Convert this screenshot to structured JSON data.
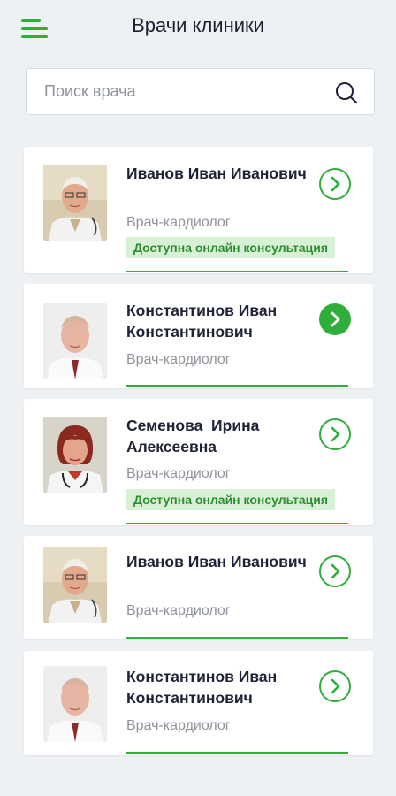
{
  "header": {
    "title": "Врачи клиники",
    "menu_icon": "hamburger-menu-icon"
  },
  "search": {
    "placeholder": "Поиск врача",
    "value": "",
    "icon": "search-icon"
  },
  "colors": {
    "accent": "#2fae3b",
    "badge_bg": "#d8f1d6",
    "badge_text": "#2c8f2f",
    "background": "#eef1f4"
  },
  "doctors": [
    {
      "name": "Иванов Иван Иванович",
      "specialty": "Врач-кардиолог",
      "badge": "Доступна онлайн консультация",
      "arrow_state": "outline"
    },
    {
      "name": "Константинов Иван Константинович",
      "specialty": "Врач-кардиолог",
      "arrow_state": "filled"
    },
    {
      "name": "Семенова  Ирина Алексеевна",
      "specialty": "Врач-кардиолог",
      "badge": "Доступна онлайн консультация",
      "arrow_state": "outline"
    },
    {
      "name": "Иванов Иван Иванович",
      "specialty": "Врач-кардиолог",
      "arrow_state": "outline"
    },
    {
      "name": "Константинов Иван Константинович",
      "specialty": "Врач-кардиолог",
      "arrow_state": "outline"
    }
  ]
}
